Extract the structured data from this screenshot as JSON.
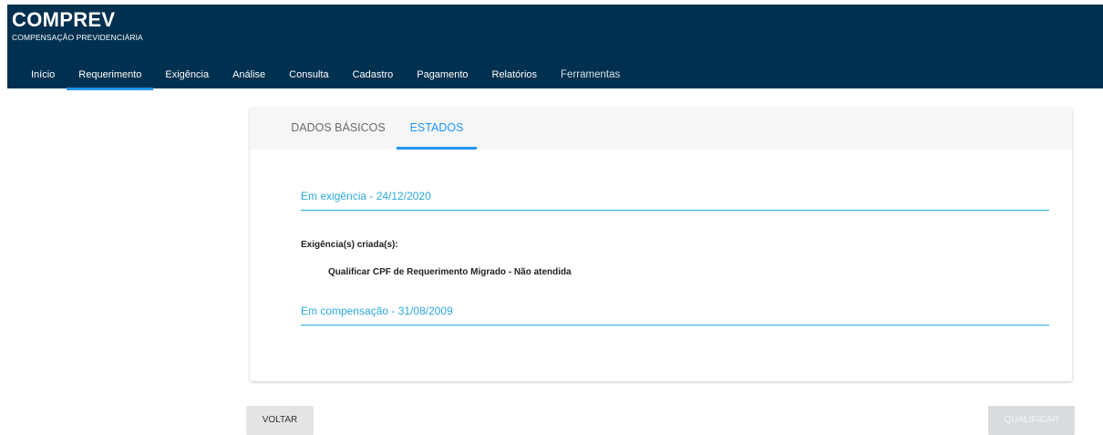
{
  "app": {
    "title": "COMPREV",
    "subtitle": "COMPENSAÇÃO PREVIDENCIÁRIA"
  },
  "nav": {
    "items": [
      {
        "label": "Início"
      },
      {
        "label": "Requerimento",
        "active": true
      },
      {
        "label": "Exigência"
      },
      {
        "label": "Análise"
      },
      {
        "label": "Consulta"
      },
      {
        "label": "Cadastro"
      },
      {
        "label": "Pagamento"
      },
      {
        "label": "Relatórios"
      },
      {
        "label": "Ferramentas"
      }
    ]
  },
  "tabs": {
    "basic": "DADOS BÁSICOS",
    "states": "ESTADOS",
    "active": "ESTADOS"
  },
  "states": [
    {
      "label": "Em exigência - 24/12/2020"
    },
    {
      "label": "Em compensação - 31/08/2009"
    }
  ],
  "requirements": {
    "label": "Exigência(s) criada(s):",
    "items": [
      "Qualificar CPF de Requerimento Migrado - Não atendida"
    ]
  },
  "actions": {
    "back": "VOLTAR",
    "qualify": "QUALIFICAR",
    "qualify_disabled": true
  },
  "colors": {
    "header_bg": "#00304f",
    "accent": "#2196f3",
    "state_text": "#29a8e0"
  }
}
